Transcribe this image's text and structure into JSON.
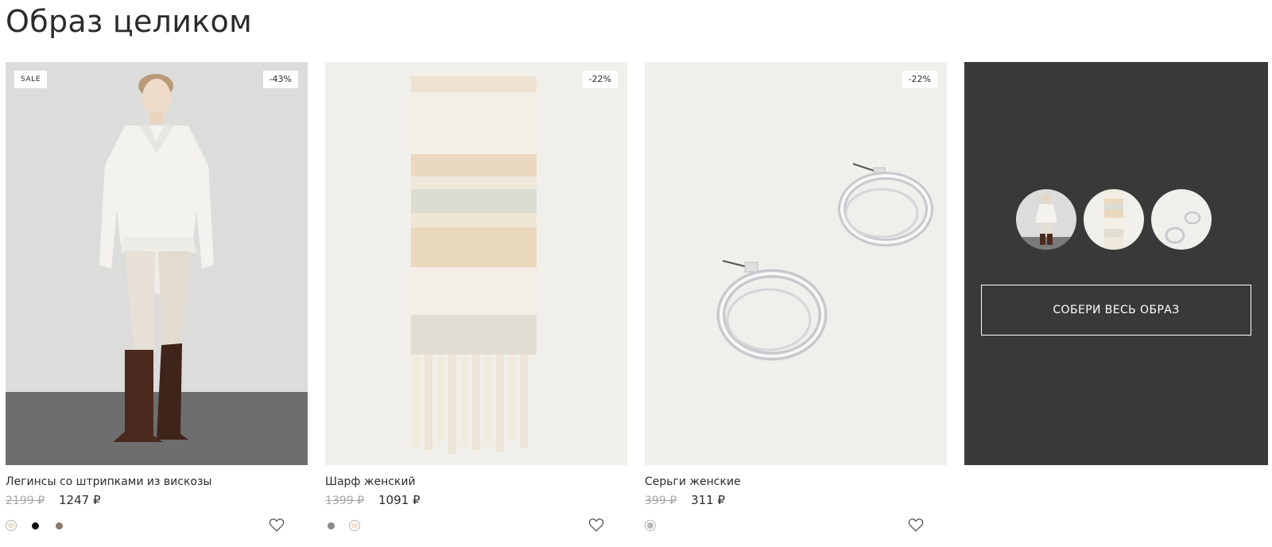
{
  "section": {
    "title": "Образ целиком"
  },
  "products": [
    {
      "name": "Легинсы со штрипками из вискозы",
      "old_price": "2199 ₽",
      "price": "1247 ₽",
      "badge": "SALE",
      "discount": "-43%",
      "colors": [
        "#efe3d3",
        "#0f0f0f",
        "#8b7765"
      ],
      "image_icon": "model-outfit-image"
    },
    {
      "name": "Шарф женский",
      "old_price": "1399 ₽",
      "price": "1091 ₽",
      "discount": "-22%",
      "colors": [
        "#8a8a8a",
        "#f5e1d2"
      ],
      "image_icon": "scarf-image"
    },
    {
      "name": "Серьги женские",
      "old_price": "399 ₽",
      "price": "311 ₽",
      "discount": "-22%",
      "colors": [
        "#b9b9b9"
      ],
      "image_icon": "earrings-image"
    }
  ],
  "look": {
    "button_label": "СОБЕРИ ВЕСЬ ОБРАЗ",
    "background": "#393939"
  },
  "icons": {
    "favorite": "heart-icon"
  }
}
